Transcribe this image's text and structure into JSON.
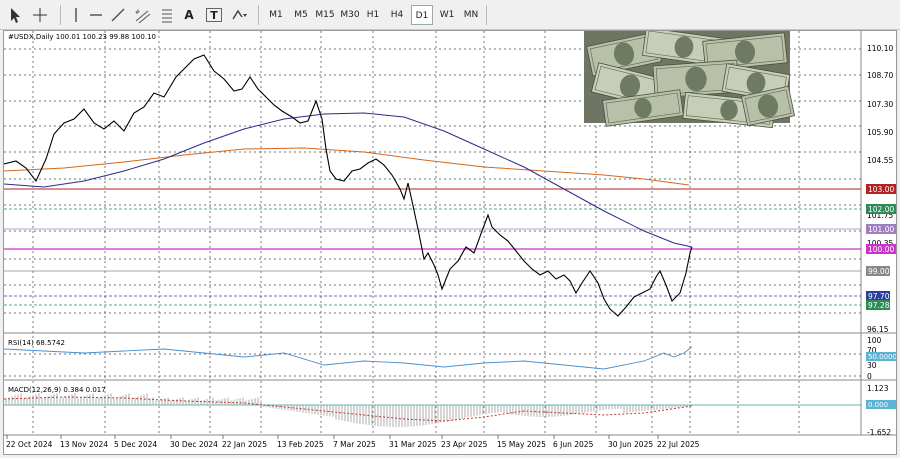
{
  "toolbar": {
    "tools": [
      "cursor-icon",
      "crosshair-icon",
      "hline-icon",
      "trendline-icon",
      "channel-icon",
      "text-icon",
      "label-icon",
      "shapes-icon"
    ],
    "text_tool_label": "A",
    "label_tool_label": "T",
    "timeframes": [
      "M1",
      "M5",
      "M15",
      "M30",
      "H1",
      "H4",
      "D1",
      "W1",
      "MN"
    ],
    "active_timeframe": "D1"
  },
  "main_chart": {
    "symbol_info": "#USDX,Daily  100.01 100.23 99.88 100.10",
    "price_labels": [
      "110.10",
      "108.70",
      "107.30",
      "105.90",
      "104.55",
      "103.15",
      "101.75",
      "100.35",
      "98.95",
      "97.55",
      "96.15"
    ],
    "level_tags": [
      {
        "text": "103.00",
        "bg": "#b22222",
        "fg": "#ffffff"
      },
      {
        "text": "102.00",
        "bg": "#2e8b57",
        "fg": "#ffffff"
      },
      {
        "text": "101.00",
        "bg": "#a07cc5",
        "fg": "#ffffff"
      },
      {
        "text": "100.00",
        "bg": "#cc33cc",
        "fg": "#ffffff"
      },
      {
        "text": "99.00",
        "bg": "#888888",
        "fg": "#ffffff"
      },
      {
        "text": "97.70",
        "bg": "#2b3fa0",
        "fg": "#ffffff"
      },
      {
        "text": "97.28",
        "bg": "#2e8b57",
        "fg": "#ffffff"
      }
    ],
    "ma_colors": {
      "fast": "#2b2b8c",
      "slow": "#d2691e"
    }
  },
  "rsi": {
    "label": "RSI(14) 68.5742",
    "scale": [
      "100",
      "70",
      "50.0000",
      "30",
      "0"
    ]
  },
  "macd": {
    "label": "MACD(12,26,9) 0.384 0.017",
    "scale": [
      "1.123",
      "0.000",
      "-1.652"
    ]
  },
  "x_axis": [
    "22 Oct 2024",
    "13 Nov 2024",
    "5 Dec 2024",
    "30 Dec 2024",
    "22 Jan 2025",
    "13 Feb 2025",
    "7 Mar 2025",
    "31 Mar 2025",
    "23 Apr 2025",
    "15 May 2025",
    "6 Jun 2025",
    "30 Jun 2025",
    "22 Jul 2025"
  ]
}
